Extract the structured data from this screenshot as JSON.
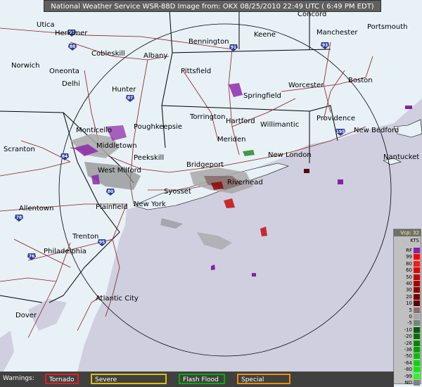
{
  "title": "National Weather Service WSR-88D Image from: OKX 08/25/2010 22:49 UTC ( 6:49 PM EDT)",
  "colors": {
    "land": "#e8f1f6",
    "water": "#cfcfe0",
    "state_line": "#000000",
    "road": "#8b1c1c",
    "range_ring": "#000000"
  },
  "cities": [
    {
      "name": "Utica"
    },
    {
      "name": "Herkimer"
    },
    {
      "name": "Concord"
    },
    {
      "name": "Portsmouth"
    },
    {
      "name": "Keene"
    },
    {
      "name": "Manchester"
    },
    {
      "name": "Bennington"
    },
    {
      "name": "Cobleskill"
    },
    {
      "name": "Albany"
    },
    {
      "name": "Norwich"
    },
    {
      "name": "Oneonta"
    },
    {
      "name": "Delhi"
    },
    {
      "name": "Pittsfield"
    },
    {
      "name": "Worcester"
    },
    {
      "name": "Boston"
    },
    {
      "name": "Hunter"
    },
    {
      "name": "Springfield"
    },
    {
      "name": "Torrington"
    },
    {
      "name": "Hartford"
    },
    {
      "name": "Providence"
    },
    {
      "name": "Willimantic"
    },
    {
      "name": "New Bedford"
    },
    {
      "name": "Monticello"
    },
    {
      "name": "Poughkeepsie"
    },
    {
      "name": "Middletown"
    },
    {
      "name": "Scranton"
    },
    {
      "name": "Peekskill"
    },
    {
      "name": "Meriden"
    },
    {
      "name": "New London"
    },
    {
      "name": "Nantucket"
    },
    {
      "name": "West Milford"
    },
    {
      "name": "Bridgeport"
    },
    {
      "name": "Riverhead"
    },
    {
      "name": "Syosset"
    },
    {
      "name": "Allentown"
    },
    {
      "name": "Plainfield"
    },
    {
      "name": "New York"
    },
    {
      "name": "Trenton"
    },
    {
      "name": "Philadelphia"
    },
    {
      "name": "Atlantic City"
    },
    {
      "name": "Dover"
    }
  ],
  "interstates": [
    "88",
    "90",
    "91",
    "93",
    "87",
    "84",
    "80",
    "95",
    "78",
    "76",
    "195"
  ],
  "legend": {
    "header": "Vcp: 32",
    "units": "KTS",
    "items": [
      {
        "label": "RF",
        "color": "#8a1fa8"
      },
      {
        "label": "99",
        "color": "#ff0000"
      },
      {
        "label": "80",
        "color": "#ff1a1a"
      },
      {
        "label": "60",
        "color": "#e00000"
      },
      {
        "label": "50",
        "color": "#c40000"
      },
      {
        "label": "40",
        "color": "#a80000"
      },
      {
        "label": "30",
        "color": "#900000"
      },
      {
        "label": "20",
        "color": "#780000"
      },
      {
        "label": "10",
        "color": "#600000"
      },
      {
        "label": "5",
        "color": "#8a6e6e"
      },
      {
        "label": "0",
        "color": "#a8a8a8"
      },
      {
        "label": "-5",
        "color": "#708a70"
      },
      {
        "label": "-10",
        "color": "#005a00"
      },
      {
        "label": "-20",
        "color": "#007000"
      },
      {
        "label": "-26",
        "color": "#008800"
      },
      {
        "label": "-36",
        "color": "#00a000"
      },
      {
        "label": "-50",
        "color": "#00c000"
      },
      {
        "label": "-64",
        "color": "#00d800"
      },
      {
        "label": "-80",
        "color": "#00ee00"
      },
      {
        "label": "-99",
        "color": "#20ff20"
      },
      {
        "label": "ND",
        "color": "#808080"
      }
    ]
  },
  "warnings": {
    "label": "Warnings:",
    "items": [
      {
        "label": "Tornado",
        "color": "#e02020"
      },
      {
        "label": "Severe Thunderstorm",
        "color": "#e0c000"
      },
      {
        "label": "Flash Flood",
        "color": "#00b000"
      },
      {
        "label": "Special Marine",
        "color": "#f08c00"
      }
    ]
  }
}
